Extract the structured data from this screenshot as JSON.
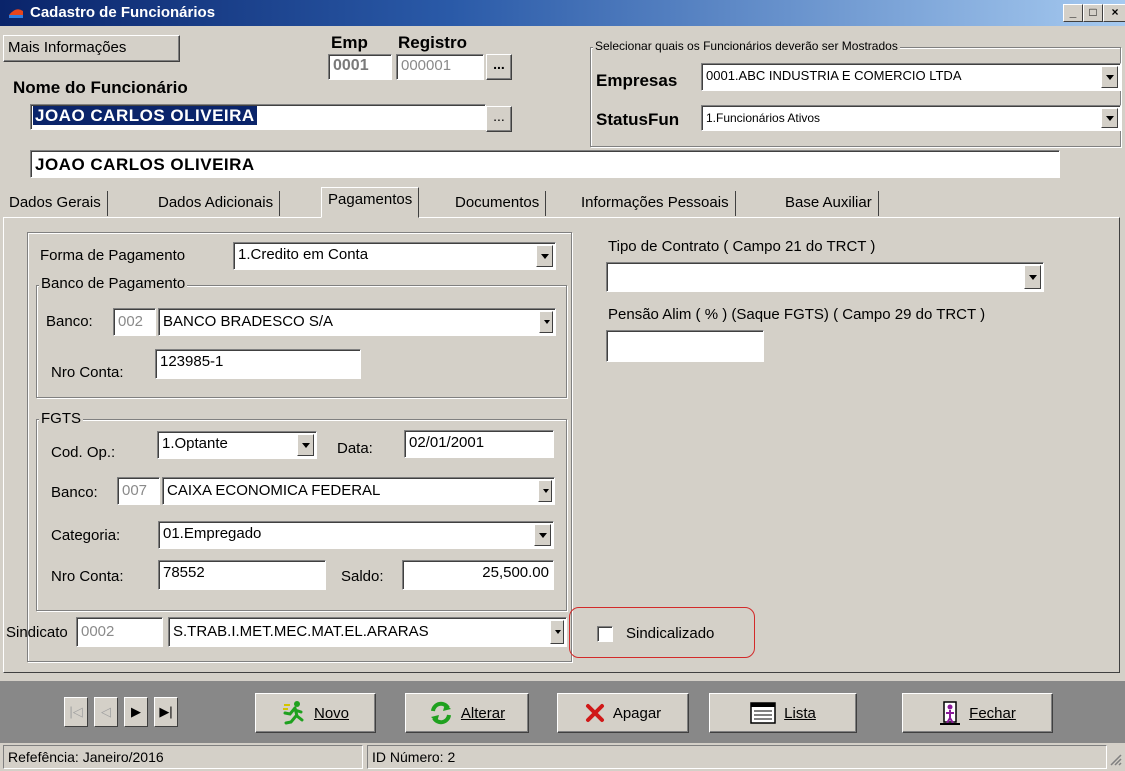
{
  "window": {
    "title": "Cadastro de Funcionários"
  },
  "header": {
    "mais_info_label": "Mais Informações",
    "emp_label": "Emp",
    "registro_label": "Registro",
    "emp_value": "0001",
    "registro_value": "000001",
    "nome_label": "Nome do Funcionário",
    "nome_value": "JOAO CARLOS OLIVEIRA",
    "nome_full_value": "JOAO CARLOS OLIVEIRA",
    "ellipsis": "..."
  },
  "filter": {
    "group_title": "Selecionar quais os Funcionários deverão ser Mostrados",
    "empresas_label": "Empresas",
    "empresas_value": "0001.ABC INDUSTRIA E COMERCIO LTDA",
    "status_label": "StatusFun",
    "status_value": "1.Funcionários Ativos"
  },
  "tabs": [
    {
      "label": "Dados Gerais"
    },
    {
      "label": "Dados Adicionais"
    },
    {
      "label": "Pagamentos"
    },
    {
      "label": "Documentos"
    },
    {
      "label": "Informações Pessoais"
    },
    {
      "label": "Base Auxiliar"
    }
  ],
  "active_tab": "Pagamentos",
  "pagamentos": {
    "forma_label": "Forma de Pagamento",
    "forma_value": "1.Credito em Conta",
    "banco_group_title": "Banco de Pagamento",
    "banco_label": "Banco:",
    "banco_code": "002",
    "banco_name": "BANCO BRADESCO S/A",
    "nro_conta_label": "Nro Conta:",
    "nro_conta_value": "123985-1",
    "fgts_group_title": "FGTS",
    "cod_op_label": "Cod. Op.:",
    "cod_op_value": "1.Optante",
    "data_label": "Data:",
    "data_value": "02/01/2001",
    "fgts_banco_label": "Banco:",
    "fgts_banco_code": "007",
    "fgts_banco_name": "CAIXA ECONOMICA FEDERAL",
    "categoria_label": "Categoria:",
    "categoria_value": "01.Empregado",
    "fgts_conta_label": "Nro Conta:",
    "fgts_conta_value": "78552",
    "saldo_label": "Saldo:",
    "saldo_value": "25,500.00",
    "sindicato_label": "Sindicato",
    "sindicato_code": "0002",
    "sindicato_name": "S.TRAB.I.MET.MEC.MAT.EL.ARARAS",
    "sindicalizado_label": "Sindicalizado",
    "sindicalizado_checked": false,
    "tipo_contrato_label": "Tipo de Contrato ( Campo 21 do TRCT )",
    "tipo_contrato_value": "",
    "pensao_label": "Pensão Alim ( % ) (Saque FGTS)  ( Campo 29 do TRCT )",
    "pensao_value": ""
  },
  "toolbar": {
    "novo_label": "Novo",
    "alterar_label": "Alterar",
    "apagar_label": "Apagar",
    "lista_label": "Lista",
    "fechar_label": "Fechar"
  },
  "statusbar": {
    "referencia": "Refefência: Janeiro/2016",
    "id_numero": "ID Número: 2"
  },
  "colors": {
    "title_bar": "#0a246a",
    "window_bg": "#d4d0c8",
    "selection": "#0a246a",
    "highlight_ring": "#d22a2a"
  }
}
